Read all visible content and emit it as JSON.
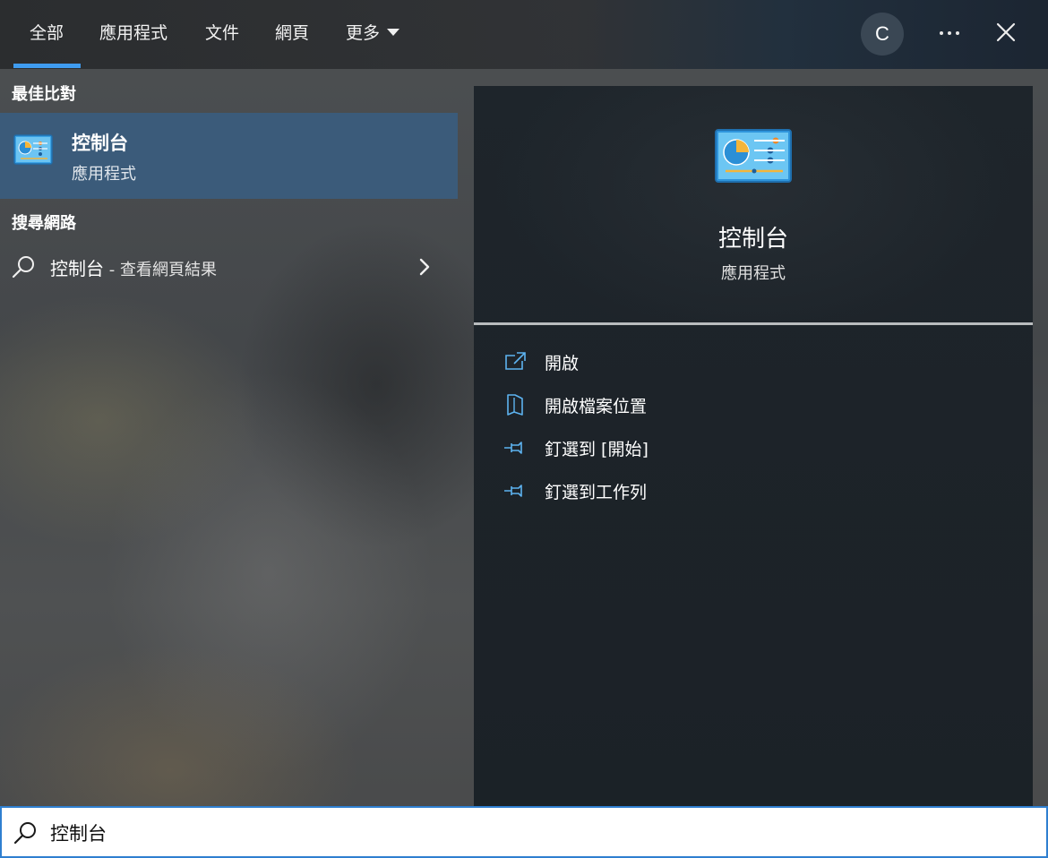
{
  "tabs": [
    {
      "label": "全部",
      "active": true
    },
    {
      "label": "應用程式"
    },
    {
      "label": "文件"
    },
    {
      "label": "網頁"
    },
    {
      "label": "更多"
    }
  ],
  "header": {
    "avatar_initial": "C",
    "accent_color": "#3f9cf0"
  },
  "best_match": {
    "section_label": "最佳比對",
    "title": "控制台",
    "subtitle": "應用程式",
    "icon": "control-panel-icon"
  },
  "web_search": {
    "section_label": "搜尋網路",
    "query": "控制台",
    "suffix": " - 查看網頁結果"
  },
  "detail": {
    "title": "控制台",
    "subtitle": "應用程式",
    "actions": [
      {
        "label": "開啟",
        "icon": "open-external-icon"
      },
      {
        "label": "開啟檔案位置",
        "icon": "folder-location-icon"
      },
      {
        "label": "釘選到 [開始]",
        "icon": "pin-icon"
      },
      {
        "label": "釘選到工作列",
        "icon": "pin-icon"
      }
    ]
  },
  "search": {
    "value": "控制台"
  }
}
